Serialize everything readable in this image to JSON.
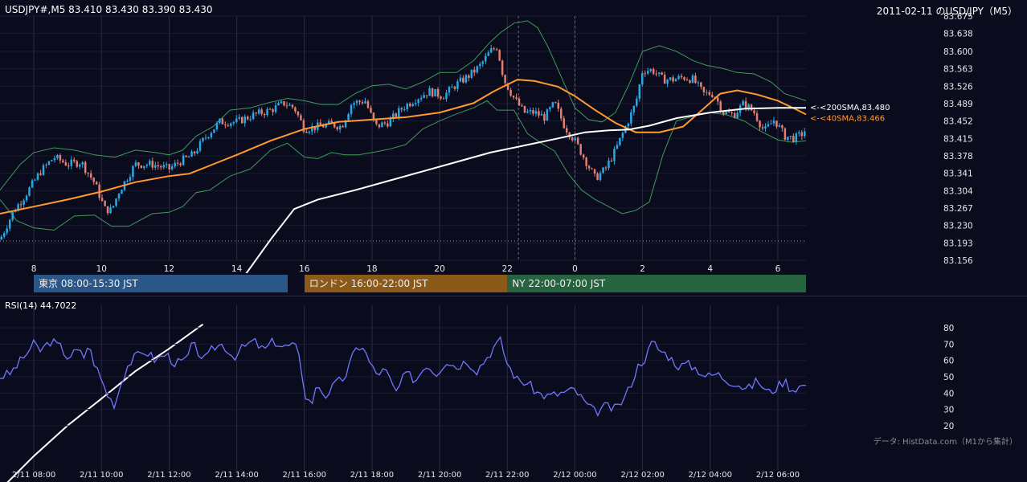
{
  "header": {
    "left": "USDJPY#,M5 83.410 83.430 83.390 83.430",
    "right": "2011-02-11 のUSD/JPY（M5）"
  },
  "footer_credit": "データ: HistData.com（M1から集計）",
  "colors": {
    "background": "#0b0b1e",
    "candle_up": "#26a9e6",
    "candle_down": "#e27f6e",
    "bollinger": "#3f9a59",
    "sma40": "#ff9a2e",
    "sma200": "#ffffff",
    "rsi": "#6f78ff"
  },
  "sessions": [
    {
      "label": "東京 08:00-15:30 JST",
      "color": "#2a5788"
    },
    {
      "label": "ロンドン 16:00-22:00 JST",
      "color": "#8c5a18"
    },
    {
      "label": "NY 22:00-07:00 JST",
      "color": "#26633f"
    }
  ],
  "chart_data": [
    {
      "type": "candlestick",
      "title": "USDJPY#,M5",
      "ylim": [
        83.156,
        83.675
      ],
      "y_ticks": [
        "83.675",
        "83.638",
        "83.600",
        "83.563",
        "83.526",
        "83.489",
        "83.452",
        "83.415",
        "83.378",
        "83.341",
        "83.304",
        "83.267",
        "83.230",
        "83.193",
        "83.156"
      ],
      "x_ticks": [
        "8",
        "10",
        "12",
        "14",
        "16",
        "18",
        "20",
        "22",
        "0",
        "2",
        "4",
        "6"
      ],
      "x_hours": [
        8,
        10,
        12,
        14,
        16,
        18,
        20,
        22,
        24,
        26,
        28,
        30
      ],
      "x_range_hours": [
        7.0,
        30.833
      ],
      "last_close": 83.43,
      "indicators": [
        {
          "name": "200SMA",
          "label": "<-<200SMA,83.480",
          "value": 83.48,
          "color": "#ffffff"
        },
        {
          "name": "40SMA",
          "label": "<-<40SMA,83.466",
          "value": 83.466,
          "color": "#ff9a2e"
        },
        {
          "name": "Bollinger Bands",
          "color": "#3f9a59"
        }
      ],
      "close_path": [
        [
          7.0,
          83.2
        ],
        [
          7.4,
          83.26
        ],
        [
          7.8,
          83.3
        ],
        [
          8.2,
          83.345
        ],
        [
          8.6,
          83.375
        ],
        [
          9.0,
          83.36
        ],
        [
          9.4,
          83.365
        ],
        [
          9.8,
          83.32
        ],
        [
          10.1,
          83.265
        ],
        [
          10.3,
          83.262
        ],
        [
          10.5,
          83.3
        ],
        [
          11.0,
          83.36
        ],
        [
          11.5,
          83.36
        ],
        [
          12.0,
          83.35
        ],
        [
          12.3,
          83.365
        ],
        [
          12.7,
          83.38
        ],
        [
          13.1,
          83.42
        ],
        [
          13.5,
          83.45
        ],
        [
          14.0,
          83.45
        ],
        [
          14.5,
          83.465
        ],
        [
          15.0,
          83.475
        ],
        [
          15.4,
          83.49
        ],
        [
          15.7,
          83.48
        ],
        [
          16.0,
          83.435
        ],
        [
          16.4,
          83.44
        ],
        [
          16.8,
          83.445
        ],
        [
          17.1,
          83.44
        ],
        [
          17.4,
          83.49
        ],
        [
          17.8,
          83.495
        ],
        [
          18.1,
          83.44
        ],
        [
          18.5,
          83.45
        ],
        [
          18.9,
          83.48
        ],
        [
          19.3,
          83.5
        ],
        [
          19.7,
          83.515
        ],
        [
          20.1,
          83.505
        ],
        [
          20.5,
          83.53
        ],
        [
          20.9,
          83.55
        ],
        [
          21.2,
          83.57
        ],
        [
          21.5,
          83.6
        ],
        [
          21.7,
          83.61
        ],
        [
          21.9,
          83.54
        ],
        [
          22.2,
          83.5
        ],
        [
          22.5,
          83.47
        ],
        [
          22.8,
          83.47
        ],
        [
          23.1,
          83.46
        ],
        [
          23.4,
          83.49
        ],
        [
          23.7,
          83.44
        ],
        [
          24.0,
          83.41
        ],
        [
          24.3,
          83.37
        ],
        [
          24.6,
          83.33
        ],
        [
          24.9,
          83.35
        ],
        [
          25.2,
          83.39
        ],
        [
          25.5,
          83.44
        ],
        [
          25.8,
          83.49
        ],
        [
          26.0,
          83.56
        ],
        [
          26.3,
          83.56
        ],
        [
          26.6,
          83.54
        ],
        [
          26.9,
          83.54
        ],
        [
          27.2,
          83.545
        ],
        [
          27.5,
          83.54
        ],
        [
          27.8,
          83.51
        ],
        [
          28.1,
          83.51
        ],
        [
          28.4,
          83.47
        ],
        [
          28.7,
          83.465
        ],
        [
          29.0,
          83.49
        ],
        [
          29.3,
          83.47
        ],
        [
          29.6,
          83.43
        ],
        [
          29.9,
          83.455
        ],
        [
          30.2,
          83.42
        ],
        [
          30.5,
          83.415
        ],
        [
          30.833,
          83.43
        ]
      ],
      "sma40_path": [
        [
          7.0,
          83.255
        ],
        [
          8.0,
          83.27
        ],
        [
          9.0,
          83.285
        ],
        [
          10.0,
          83.302
        ],
        [
          11.0,
          83.322
        ],
        [
          12.0,
          83.335
        ],
        [
          12.6,
          83.34
        ],
        [
          13.3,
          83.36
        ],
        [
          14.0,
          83.38
        ],
        [
          15.0,
          83.41
        ],
        [
          16.0,
          83.435
        ],
        [
          17.0,
          83.45
        ],
        [
          18.0,
          83.455
        ],
        [
          19.0,
          83.46
        ],
        [
          20.0,
          83.47
        ],
        [
          21.0,
          83.49
        ],
        [
          21.6,
          83.515
        ],
        [
          22.3,
          83.54
        ],
        [
          22.8,
          83.537
        ],
        [
          23.5,
          83.525
        ],
        [
          24.0,
          83.505
        ],
        [
          24.6,
          83.475
        ],
        [
          25.2,
          83.448
        ],
        [
          25.8,
          83.428
        ],
        [
          26.5,
          83.428
        ],
        [
          27.2,
          83.44
        ],
        [
          27.8,
          83.478
        ],
        [
          28.3,
          83.51
        ],
        [
          28.8,
          83.517
        ],
        [
          29.4,
          83.508
        ],
        [
          30.0,
          83.495
        ],
        [
          30.5,
          83.478
        ],
        [
          30.833,
          83.466
        ]
      ],
      "sma200_path": [
        [
          13.0,
          83.02
        ],
        [
          14.0,
          83.1
        ],
        [
          15.0,
          83.2
        ],
        [
          15.7,
          83.265
        ],
        [
          16.4,
          83.285
        ],
        [
          17.5,
          83.305
        ],
        [
          18.5,
          83.325
        ],
        [
          19.5,
          83.345
        ],
        [
          20.5,
          83.365
        ],
        [
          21.5,
          83.385
        ],
        [
          22.5,
          83.4
        ],
        [
          23.5,
          83.415
        ],
        [
          24.3,
          83.428
        ],
        [
          25.0,
          83.432
        ],
        [
          25.6,
          83.434
        ],
        [
          26.2,
          83.442
        ],
        [
          27.0,
          83.458
        ],
        [
          28.0,
          83.47
        ],
        [
          29.0,
          83.478
        ],
        [
          30.0,
          83.48
        ],
        [
          30.833,
          83.48
        ]
      ],
      "bb_upper_path": [
        [
          7.0,
          83.305
        ],
        [
          7.6,
          83.36
        ],
        [
          8.0,
          83.385
        ],
        [
          8.6,
          83.395
        ],
        [
          9.2,
          83.39
        ],
        [
          9.8,
          83.38
        ],
        [
          10.4,
          83.375
        ],
        [
          11.0,
          83.39
        ],
        [
          11.6,
          83.385
        ],
        [
          12.0,
          83.38
        ],
        [
          12.4,
          83.39
        ],
        [
          12.8,
          83.42
        ],
        [
          13.3,
          83.44
        ],
        [
          13.8,
          83.475
        ],
        [
          14.4,
          83.48
        ],
        [
          15.0,
          83.492
        ],
        [
          15.5,
          83.5
        ],
        [
          16.0,
          83.495
        ],
        [
          16.5,
          83.487
        ],
        [
          17.0,
          83.487
        ],
        [
          17.5,
          83.51
        ],
        [
          18.0,
          83.527
        ],
        [
          18.5,
          83.53
        ],
        [
          19.0,
          83.52
        ],
        [
          19.5,
          83.535
        ],
        [
          20.0,
          83.555
        ],
        [
          20.5,
          83.555
        ],
        [
          21.0,
          83.58
        ],
        [
          21.5,
          83.62
        ],
        [
          21.8,
          83.64
        ],
        [
          22.2,
          83.66
        ],
        [
          22.6,
          83.665
        ],
        [
          22.9,
          83.65
        ],
        [
          23.2,
          83.61
        ],
        [
          23.6,
          83.545
        ],
        [
          24.0,
          83.48
        ],
        [
          24.4,
          83.455
        ],
        [
          24.8,
          83.45
        ],
        [
          25.2,
          83.47
        ],
        [
          25.6,
          83.53
        ],
        [
          26.0,
          83.6
        ],
        [
          26.5,
          83.612
        ],
        [
          27.0,
          83.6
        ],
        [
          27.5,
          83.58
        ],
        [
          27.9,
          83.57
        ],
        [
          28.3,
          83.565
        ],
        [
          28.8,
          83.555
        ],
        [
          29.3,
          83.552
        ],
        [
          29.8,
          83.535
        ],
        [
          30.2,
          83.51
        ],
        [
          30.833,
          83.495
        ]
      ],
      "bb_lower_path": [
        [
          7.0,
          83.285
        ],
        [
          7.5,
          83.24
        ],
        [
          8.0,
          83.225
        ],
        [
          8.6,
          83.22
        ],
        [
          9.2,
          83.25
        ],
        [
          9.8,
          83.252
        ],
        [
          10.3,
          83.228
        ],
        [
          10.8,
          83.228
        ],
        [
          11.5,
          83.255
        ],
        [
          12.0,
          83.258
        ],
        [
          12.4,
          83.27
        ],
        [
          12.8,
          83.3
        ],
        [
          13.2,
          83.305
        ],
        [
          13.8,
          83.335
        ],
        [
          14.4,
          83.35
        ],
        [
          15.0,
          83.39
        ],
        [
          15.5,
          83.405
        ],
        [
          16.0,
          83.375
        ],
        [
          16.4,
          83.372
        ],
        [
          16.8,
          83.385
        ],
        [
          17.2,
          83.38
        ],
        [
          17.6,
          83.38
        ],
        [
          18.0,
          83.385
        ],
        [
          18.5,
          83.392
        ],
        [
          19.0,
          83.402
        ],
        [
          19.5,
          83.435
        ],
        [
          20.0,
          83.452
        ],
        [
          20.5,
          83.467
        ],
        [
          21.0,
          83.48
        ],
        [
          21.4,
          83.495
        ],
        [
          21.7,
          83.475
        ],
        [
          22.2,
          83.475
        ],
        [
          22.6,
          83.425
        ],
        [
          23.0,
          83.405
        ],
        [
          23.4,
          83.388
        ],
        [
          23.8,
          83.34
        ],
        [
          24.2,
          83.305
        ],
        [
          24.6,
          83.285
        ],
        [
          25.0,
          83.27
        ],
        [
          25.4,
          83.255
        ],
        [
          25.8,
          83.262
        ],
        [
          26.2,
          83.28
        ],
        [
          26.6,
          83.38
        ],
        [
          27.0,
          83.452
        ],
        [
          27.5,
          83.462
        ],
        [
          28.0,
          83.47
        ],
        [
          28.5,
          83.465
        ],
        [
          29.0,
          83.452
        ],
        [
          29.5,
          83.43
        ],
        [
          30.0,
          83.412
        ],
        [
          30.4,
          83.407
        ],
        [
          30.833,
          83.41
        ]
      ],
      "reference_level": 83.197
    },
    {
      "type": "line",
      "title": "RSI(14) 44.7022",
      "ylim": [
        20,
        80
      ],
      "y_ticks": [
        "80",
        "70",
        "60",
        "50",
        "40",
        "30",
        "20"
      ],
      "last_value": 44.7022,
      "values": [
        [
          7.0,
          50
        ],
        [
          7.3,
          52
        ],
        [
          7.7,
          62
        ],
        [
          8.0,
          70
        ],
        [
          8.2,
          66
        ],
        [
          8.5,
          72
        ],
        [
          8.8,
          68
        ],
        [
          9.0,
          62
        ],
        [
          9.3,
          66
        ],
        [
          9.5,
          62
        ],
        [
          9.6,
          70
        ],
        [
          9.8,
          58
        ],
        [
          10.0,
          48
        ],
        [
          10.2,
          38
        ],
        [
          10.4,
          33
        ],
        [
          10.6,
          48
        ],
        [
          10.8,
          58
        ],
        [
          11.0,
          62
        ],
        [
          11.3,
          66
        ],
        [
          11.6,
          60
        ],
        [
          11.9,
          64
        ],
        [
          12.2,
          58
        ],
        [
          12.5,
          60
        ],
        [
          12.7,
          70
        ],
        [
          12.9,
          64
        ],
        [
          13.1,
          60
        ],
        [
          13.3,
          68
        ],
        [
          13.6,
          70
        ],
        [
          13.9,
          62
        ],
        [
          14.2,
          68
        ],
        [
          14.5,
          72
        ],
        [
          14.8,
          66
        ],
        [
          15.1,
          72
        ],
        [
          15.4,
          68
        ],
        [
          15.7,
          70
        ],
        [
          15.9,
          58
        ],
        [
          16.0,
          40
        ],
        [
          16.2,
          33
        ],
        [
          16.4,
          46
        ],
        [
          16.6,
          38
        ],
        [
          16.9,
          45
        ],
        [
          17.2,
          50
        ],
        [
          17.5,
          66
        ],
        [
          17.7,
          70
        ],
        [
          17.9,
          60
        ],
        [
          18.1,
          52
        ],
        [
          18.4,
          54
        ],
        [
          18.7,
          40
        ],
        [
          19.0,
          52
        ],
        [
          19.3,
          48
        ],
        [
          19.6,
          58
        ],
        [
          19.9,
          52
        ],
        [
          20.2,
          60
        ],
        [
          20.5,
          56
        ],
        [
          20.8,
          60
        ],
        [
          21.1,
          54
        ],
        [
          21.4,
          62
        ],
        [
          21.6,
          68
        ],
        [
          21.8,
          72
        ],
        [
          22.0,
          58
        ],
        [
          22.3,
          48
        ],
        [
          22.6,
          46
        ],
        [
          22.9,
          40
        ],
        [
          23.2,
          38
        ],
        [
          23.6,
          40
        ],
        [
          24.0,
          42
        ],
        [
          24.3,
          34
        ],
        [
          24.6,
          28
        ],
        [
          24.9,
          32
        ],
        [
          25.2,
          30
        ],
        [
          25.5,
          38
        ],
        [
          25.7,
          48
        ],
        [
          25.9,
          58
        ],
        [
          26.1,
          62
        ],
        [
          26.3,
          72
        ],
        [
          26.5,
          66
        ],
        [
          26.7,
          64
        ],
        [
          26.9,
          60
        ],
        [
          27.1,
          56
        ],
        [
          27.3,
          58
        ],
        [
          27.6,
          55
        ],
        [
          27.9,
          50
        ],
        [
          28.2,
          52
        ],
        [
          28.5,
          48
        ],
        [
          28.8,
          46
        ],
        [
          29.1,
          42
        ],
        [
          29.4,
          48
        ],
        [
          29.7,
          40
        ],
        [
          30.0,
          44
        ],
        [
          30.2,
          48
        ],
        [
          30.4,
          42
        ],
        [
          30.6,
          44
        ],
        [
          30.833,
          44.7
        ]
      ]
    }
  ],
  "time_axis": [
    "2/11 08:00",
    "2/11 10:00",
    "2/11 12:00",
    "2/11 14:00",
    "2/11 16:00",
    "2/11 18:00",
    "2/11 20:00",
    "2/11 22:00",
    "2/12 00:00",
    "2/12 02:00",
    "2/12 04:00",
    "2/12 06:00"
  ]
}
